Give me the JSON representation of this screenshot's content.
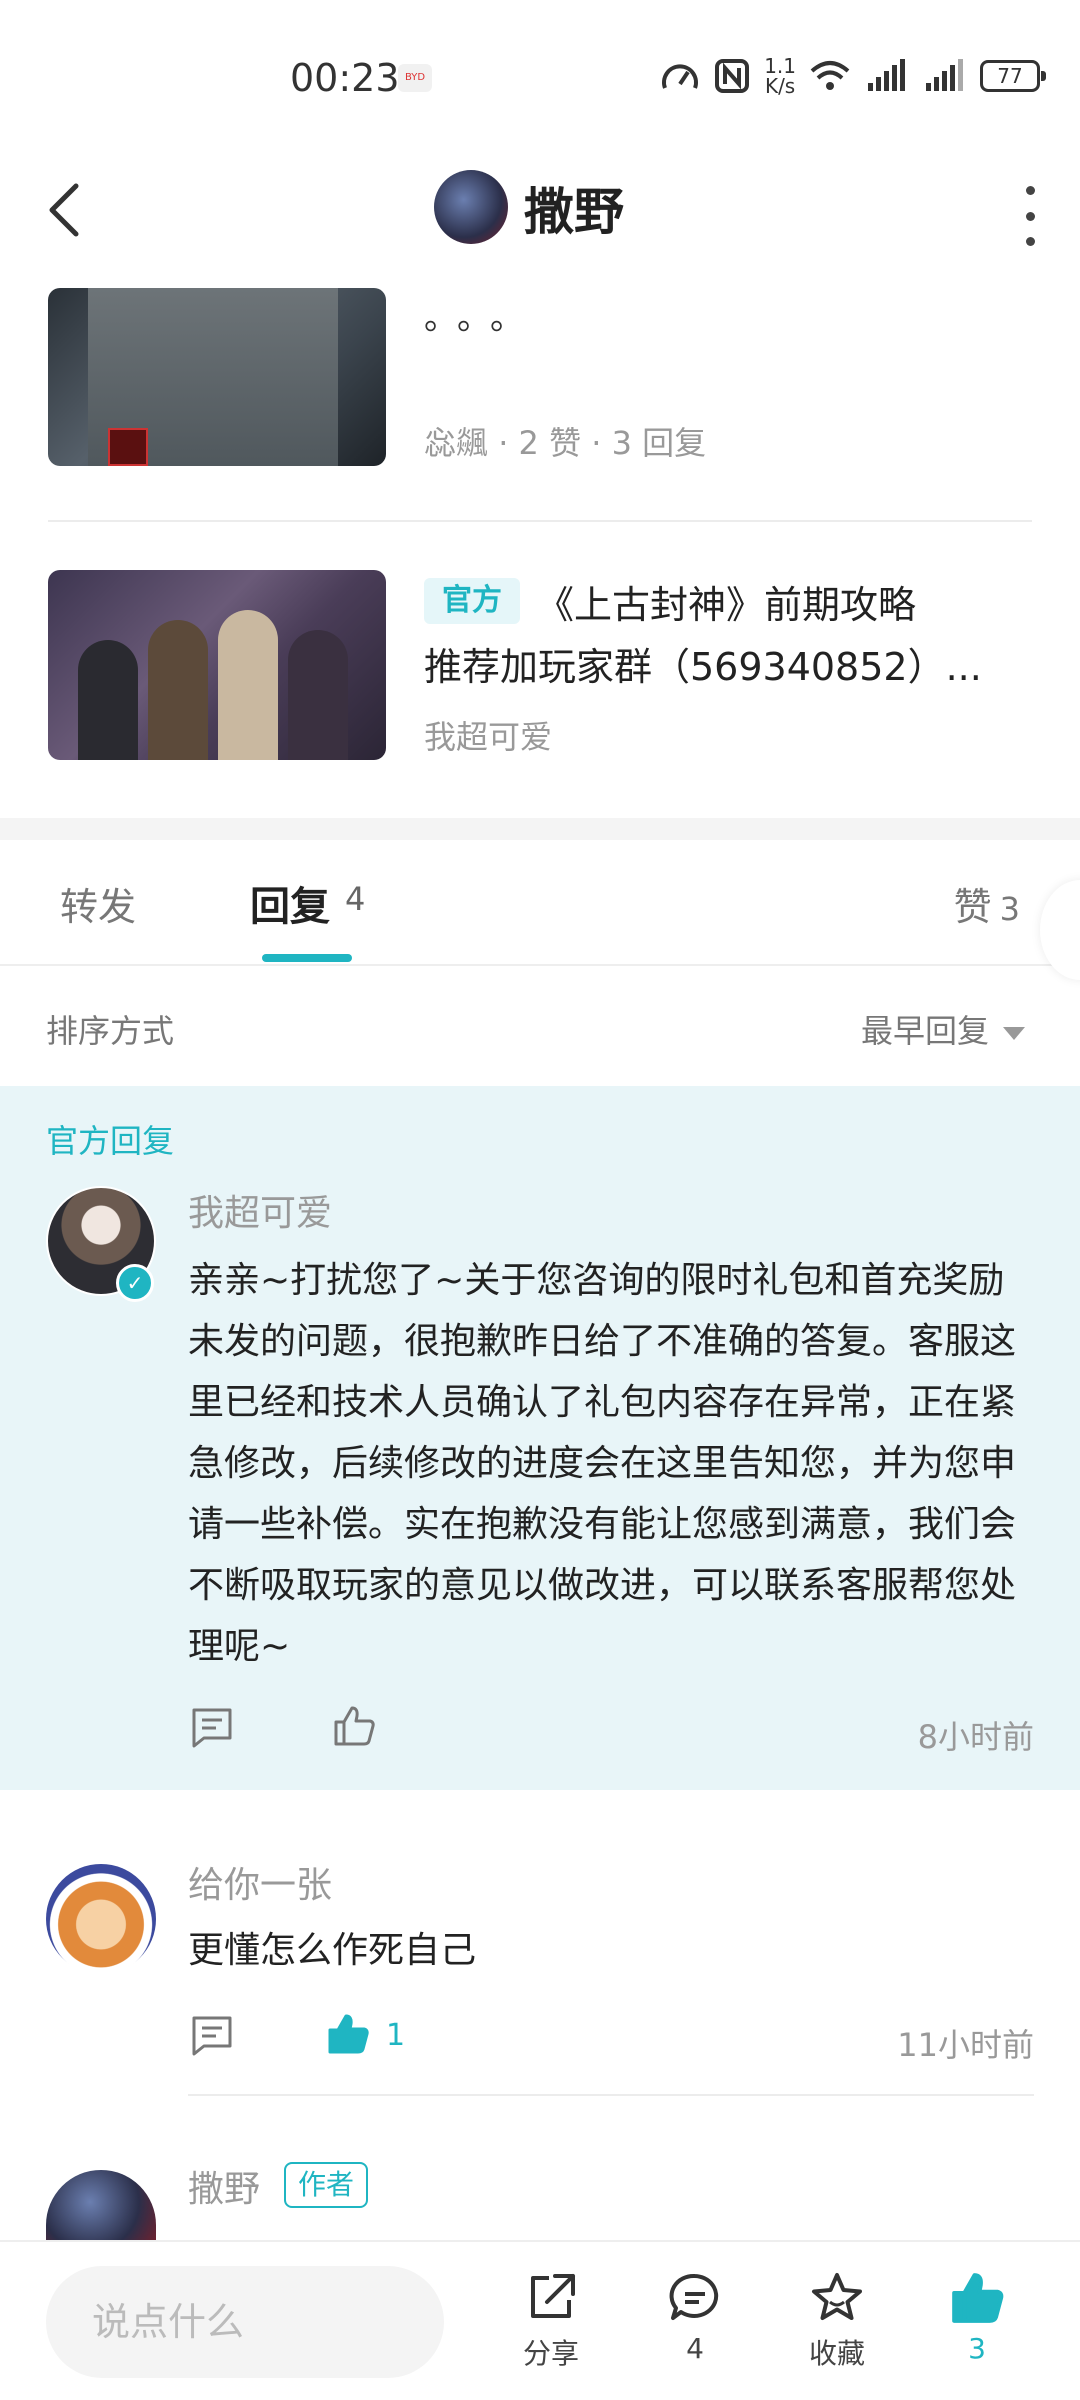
{
  "status_bar": {
    "time": "00:23",
    "speed_top": "1.1",
    "speed_bottom": "K/s",
    "battery": "77"
  },
  "header": {
    "title": "撒野"
  },
  "related_posts": [
    {
      "snippet": "。。。",
      "author": "惢飊",
      "likes": "2 赞",
      "replies": "3 回复"
    },
    {
      "tag": "官方",
      "title_line1": "《上古封神》前期攻略",
      "title_line2": "推荐加玩家群（569340852）...",
      "author": "我超可爱"
    }
  ],
  "tabs": {
    "forward": "转发",
    "reply": "回复",
    "reply_count": "4",
    "like": "赞",
    "like_count": "3"
  },
  "sort": {
    "label": "排序方式",
    "value": "最早回复"
  },
  "official_reply": {
    "section_label": "官方回复",
    "name": "我超可爱",
    "body": "亲亲~打扰您了~关于您咨询的限时礼包和首充奖励未发的问题，很抱歉昨日给了不准确的答复。客服这里已经和技术人员确认了礼包内容存在异常，正在紧急修改，后续修改的进度会在这里告知您，并为您申请一些补偿。实在抱歉没有能让您感到满意，我们会不断吸取玩家的意见以做改进，可以联系客服帮您处理呢~",
    "time": "8小时前"
  },
  "comments": [
    {
      "name": "给你一张",
      "body": "更懂怎么作死自己",
      "like_count": "1",
      "time": "11小时前"
    },
    {
      "name": "撒野",
      "tag": "作者"
    }
  ],
  "bottom_bar": {
    "input_placeholder": "说点什么",
    "share": "分享",
    "comments": "4",
    "favorite": "收藏",
    "likes": "3"
  },
  "colors": {
    "accent": "#1fb5c2",
    "official_bg": "#e8f5f8"
  }
}
